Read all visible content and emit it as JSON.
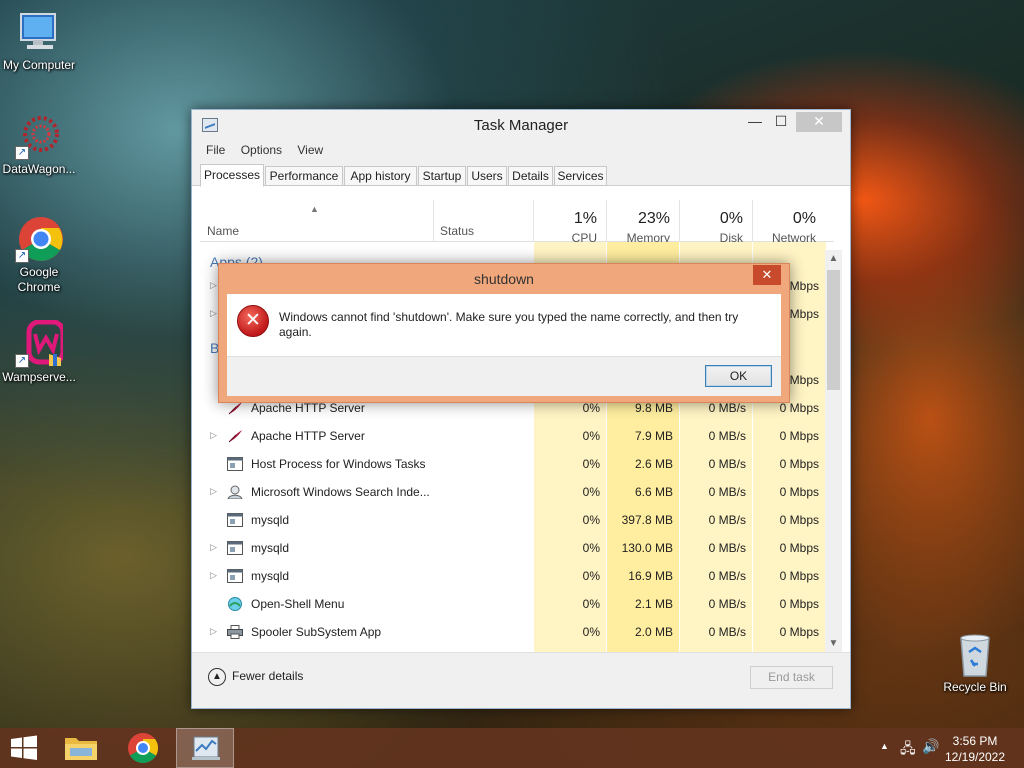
{
  "desktop": {
    "icons": [
      {
        "label": "My Computer"
      },
      {
        "label": "DataWagon..."
      },
      {
        "label": "Google Chrome"
      },
      {
        "label": "Wampserve..."
      },
      {
        "label": "Recycle Bin"
      }
    ]
  },
  "task_manager": {
    "title": "Task Manager",
    "menu": [
      "File",
      "Options",
      "View"
    ],
    "tabs": [
      "Processes",
      "Performance",
      "App history",
      "Startup",
      "Users",
      "Details",
      "Services"
    ],
    "columns": {
      "name": "Name",
      "status": "Status",
      "cpu": {
        "pct": "1%",
        "label": "CPU"
      },
      "memory": {
        "pct": "23%",
        "label": "Memory"
      },
      "disk": {
        "pct": "0%",
        "label": "Disk"
      },
      "network": {
        "pct": "0%",
        "label": "Network"
      }
    },
    "groups": {
      "apps": "Apps (2)",
      "background": "B"
    },
    "partial_rows": [
      {
        "network": "Mbps"
      },
      {
        "network": "Mbps"
      },
      {
        "network": "Mbps"
      }
    ],
    "rows": [
      {
        "name": "Apache HTTP Server",
        "cpu": "0%",
        "memory": "9.8 MB",
        "disk": "0 MB/s",
        "network": "0 Mbps",
        "expandable": false,
        "icon": "feather-icon"
      },
      {
        "name": "Apache HTTP Server",
        "cpu": "0%",
        "memory": "7.9 MB",
        "disk": "0 MB/s",
        "network": "0 Mbps",
        "expandable": true,
        "icon": "feather-icon"
      },
      {
        "name": "Host Process for Windows Tasks",
        "cpu": "0%",
        "memory": "2.6 MB",
        "disk": "0 MB/s",
        "network": "0 Mbps",
        "expandable": false,
        "icon": "window-icon"
      },
      {
        "name": "Microsoft Windows Search Inde...",
        "cpu": "0%",
        "memory": "6.6 MB",
        "disk": "0 MB/s",
        "network": "0 Mbps",
        "expandable": true,
        "icon": "search-user-icon"
      },
      {
        "name": "mysqld",
        "cpu": "0%",
        "memory": "397.8 MB",
        "disk": "0 MB/s",
        "network": "0 Mbps",
        "expandable": false,
        "icon": "window-icon"
      },
      {
        "name": "mysqld",
        "cpu": "0%",
        "memory": "130.0 MB",
        "disk": "0 MB/s",
        "network": "0 Mbps",
        "expandable": true,
        "icon": "window-icon"
      },
      {
        "name": "mysqld",
        "cpu": "0%",
        "memory": "16.9 MB",
        "disk": "0 MB/s",
        "network": "0 Mbps",
        "expandable": true,
        "icon": "window-icon"
      },
      {
        "name": "Open-Shell Menu",
        "cpu": "0%",
        "memory": "2.1 MB",
        "disk": "0 MB/s",
        "network": "0 Mbps",
        "expandable": false,
        "icon": "shell-icon"
      },
      {
        "name": "Spooler SubSystem App",
        "cpu": "0%",
        "memory": "2.0 MB",
        "disk": "0 MB/s",
        "network": "0 Mbps",
        "expandable": true,
        "icon": "printer-icon"
      }
    ],
    "footer": {
      "fewer_details": "Fewer details",
      "end_task": "End task"
    }
  },
  "dialog": {
    "title": "shutdown",
    "message": "Windows cannot find 'shutdown'. Make sure you typed the name correctly, and then try again.",
    "ok": "OK"
  },
  "taskbar": {
    "time": "3:56 PM",
    "date": "12/19/2022"
  },
  "colors": {
    "accent_blue": "#4a79b8",
    "cpu_col_bg": "#fff4c4",
    "memory_col_bg": "#ffeea0",
    "dialog_frame": "#f0a77c",
    "taskbar": "#62341e"
  }
}
